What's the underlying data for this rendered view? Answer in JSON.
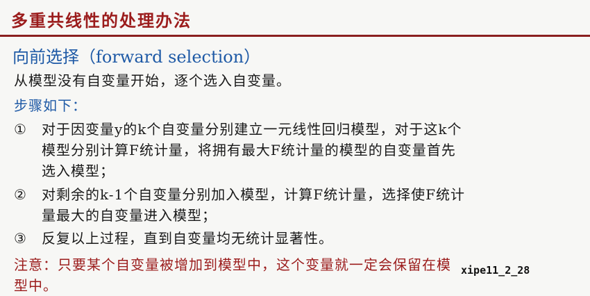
{
  "title": "多重共线性的处理办法",
  "subtitle": "向前选择（forward selection）",
  "intro": "从模型没有自变量开始，逐个选入自变量。",
  "steps_label": "步骤如下：",
  "steps": [
    {
      "number": "①",
      "lines": [
        "对于因变量y的k个自变量分别建立一元线性回归模型，对于这k个",
        "模型分别计算F统计量，将拥有最大F统计量的模型的自变量首先",
        "选入模型；"
      ]
    },
    {
      "number": "②",
      "lines": [
        "对剩余的k-1个自变量分别加入模型，计算F统计量，选择使F统计",
        "量最大的自变量进入模型；"
      ]
    },
    {
      "number": "③",
      "lines": [
        "反复以上过程，直到自变量均无统计显著性。"
      ]
    }
  ],
  "note": {
    "lines": [
      "注意：只要某个自变量被增加到模型中，这个变量就一定会保留在模",
      "型中。"
    ]
  },
  "watermark": "xipe11_2_28"
}
